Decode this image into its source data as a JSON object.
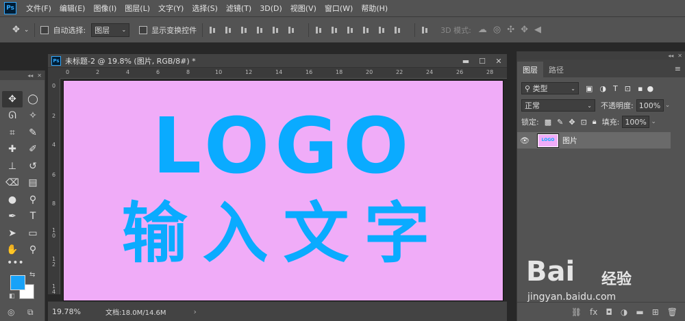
{
  "menubar": {
    "logo": "Ps",
    "items": [
      "文件(F)",
      "编辑(E)",
      "图像(I)",
      "图层(L)",
      "文字(Y)",
      "选择(S)",
      "滤镜(T)",
      "3D(D)",
      "视图(V)",
      "窗口(W)",
      "帮助(H)"
    ]
  },
  "options": {
    "auto_select_label": "自动选择:",
    "auto_select_value": "图层",
    "show_transform_label": "显示变换控件",
    "mode_3d_label": "3D 模式:"
  },
  "document": {
    "icon_label": "Ps",
    "title": "未标题-2 @ 19.8% (图片, RGB/8#) *",
    "canvas_color": "#f0acf8",
    "text_color": "#0aabff",
    "logo_text": "LOGO",
    "subtitle_text": "输入文字",
    "ruler_top": [
      "0",
      "2",
      "4",
      "6",
      "8",
      "10",
      "12",
      "14",
      "16",
      "18",
      "20",
      "22",
      "24",
      "26",
      "28"
    ],
    "ruler_left": [
      "0",
      "2",
      "4",
      "6",
      "8",
      "1 0",
      "1 2",
      "1 4"
    ],
    "zoom": "19.78%",
    "doc_info": "文档:18.0M/14.6M"
  },
  "tools": {
    "foreground_color": "#18a2f8",
    "background_color": "#ffffff"
  },
  "layers_panel": {
    "tabs": [
      "图层",
      "路径"
    ],
    "filter_kind": "类型",
    "blend_mode": "正常",
    "opacity_label": "不透明度:",
    "opacity_value": "100%",
    "lock_label": "锁定:",
    "fill_label": "填充:",
    "fill_value": "100%",
    "layer_name": "图片",
    "thumb_top": "LOGO",
    "thumb_bottom": "输入文字"
  },
  "watermark": {
    "brand": "Bai",
    "brand2": "经验",
    "url": "jingyan.baidu.com"
  }
}
